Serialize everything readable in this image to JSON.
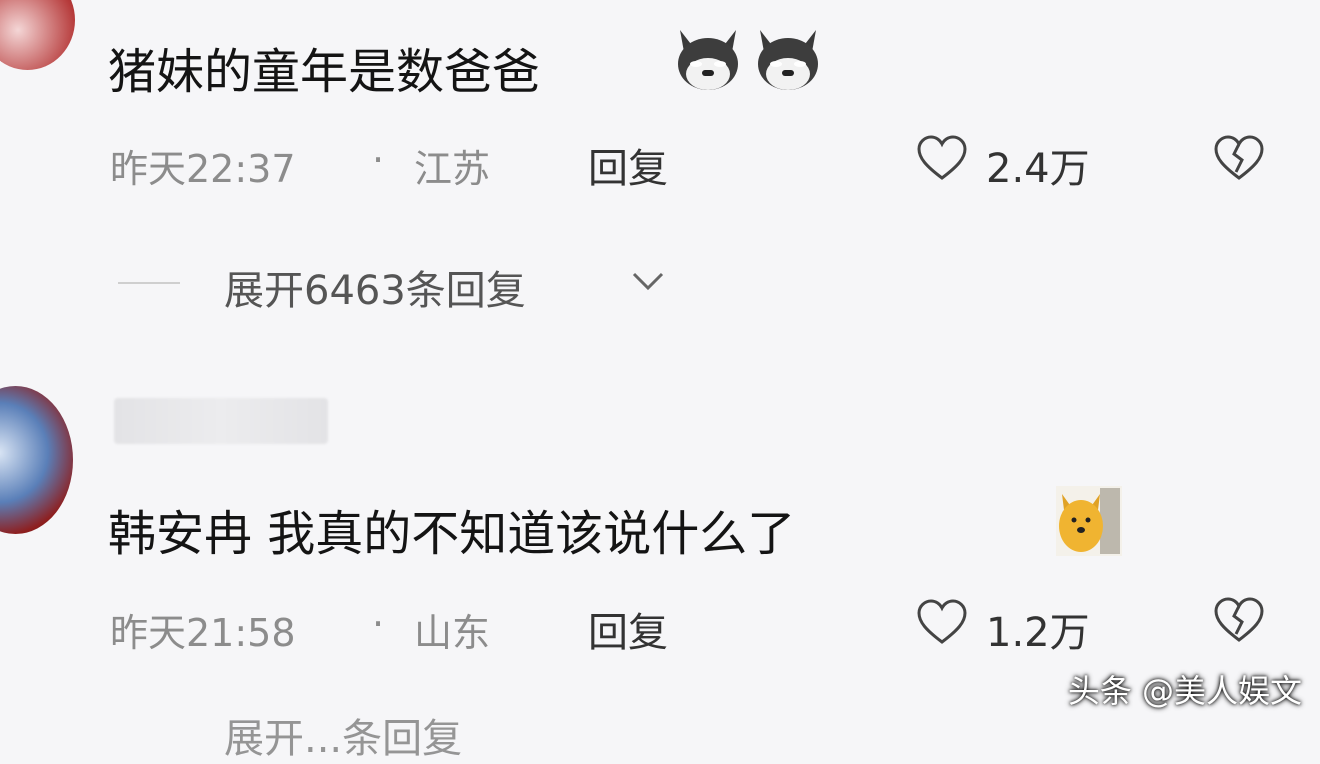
{
  "comments": [
    {
      "text": "猪妹的童年是数爸爸",
      "time": "昨天22:37",
      "location": "江苏",
      "separator": "·",
      "reply_label": "回复",
      "likes": "2.4万",
      "expand_label": "展开6463条回复"
    },
    {
      "text": "韩安冉  我真的不知道该说什么了",
      "time": "昨天21:58",
      "location": "山东",
      "separator": "·",
      "reply_label": "回复",
      "likes": "1.2万",
      "expand_label": "展开...条回复"
    }
  ],
  "watermark": "头条 @美人娱文",
  "icons": {
    "emoji_1": "husky-dog-emoji",
    "emoji_2": "golden-dog-emoji",
    "like": "heart-outline-icon",
    "dislike": "broken-heart-icon",
    "expand": "chevron-down-icon"
  }
}
